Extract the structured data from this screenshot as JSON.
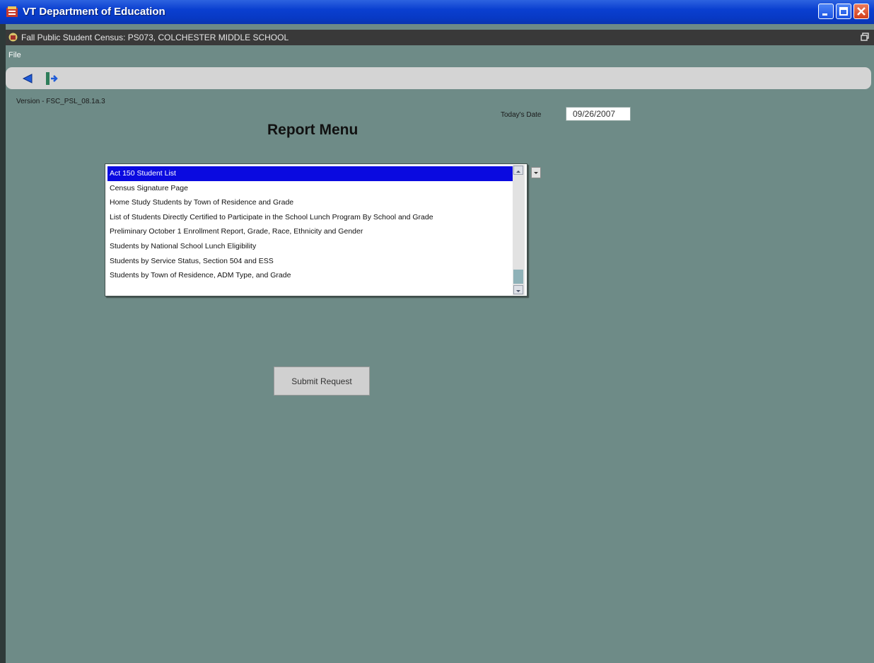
{
  "window": {
    "title": "VT Department of Education"
  },
  "subwindow": {
    "title": "Fall Public Student Census:  PS073, COLCHESTER MIDDLE SCHOOL"
  },
  "menu": {
    "file": "File"
  },
  "toolbar": {
    "icons": [
      "back-arrow-icon",
      "exit-door-icon"
    ]
  },
  "form": {
    "version": "Version - FSC_PSL_08.1a.3",
    "date_label": "Today's Date",
    "date_value": "09/26/2007",
    "title": "Report Menu",
    "reports": [
      "Act 150 Student List",
      "Census Signature Page",
      "Home Study Students by Town of Residence and Grade",
      "List of Students Directly Certified to Participate in the School Lunch Program By School and Grade",
      "Preliminary October 1 Enrollment Report, Grade, Race, Ethnicity and Gender",
      "Students by National School Lunch Eligibility",
      "Students by Service Status, Section 504 and ESS",
      "Students by Town of Residence, ADM Type, and Grade"
    ],
    "selected_report": "Act 150 Student List",
    "submit_label": "Submit Request"
  },
  "colors": {
    "background": "#6e8b87",
    "titlebar": "#0a3fd0",
    "selection": "#0a0ae0"
  }
}
